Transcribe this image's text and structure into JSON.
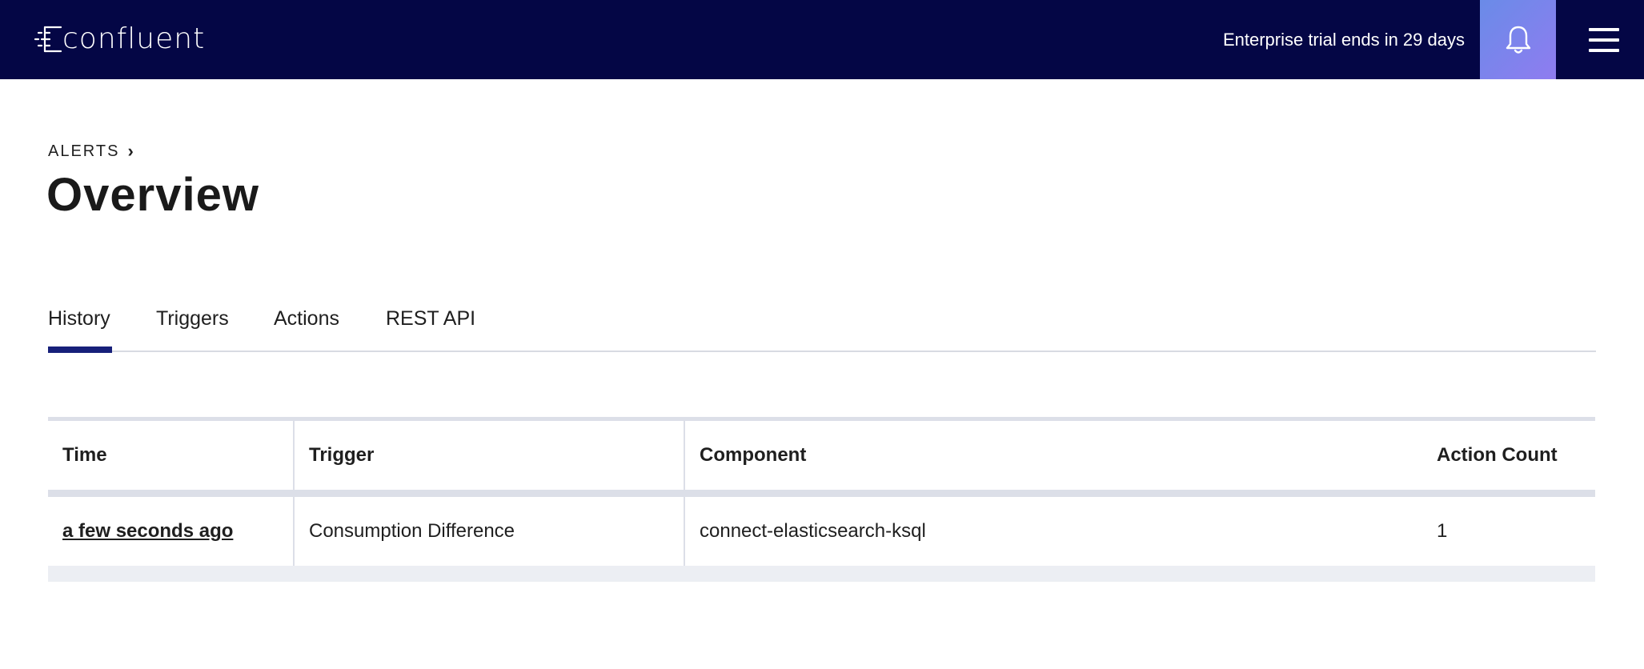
{
  "brand": {
    "name": "confluent"
  },
  "header": {
    "trial_text": "Enterprise trial ends in 29 days",
    "icons": {
      "notifications": "bell-icon",
      "menu": "hamburger-menu-icon"
    },
    "colors": {
      "navbar": "#040645",
      "bell_accent": "#7c86ec"
    }
  },
  "breadcrumb": {
    "label": "ALERTS",
    "separator": "›"
  },
  "page": {
    "title": "Overview"
  },
  "tabs": [
    {
      "label": "History",
      "active": true
    },
    {
      "label": "Triggers",
      "active": false
    },
    {
      "label": "Actions",
      "active": false
    },
    {
      "label": "REST API",
      "active": false
    }
  ],
  "table": {
    "columns": [
      "Time",
      "Trigger",
      "Component",
      "Action Count"
    ],
    "rows": [
      {
        "time": "a few seconds ago",
        "trigger": "Consumption Difference",
        "component": "connect-elasticsearch-ksql",
        "action_count": "1"
      }
    ]
  }
}
